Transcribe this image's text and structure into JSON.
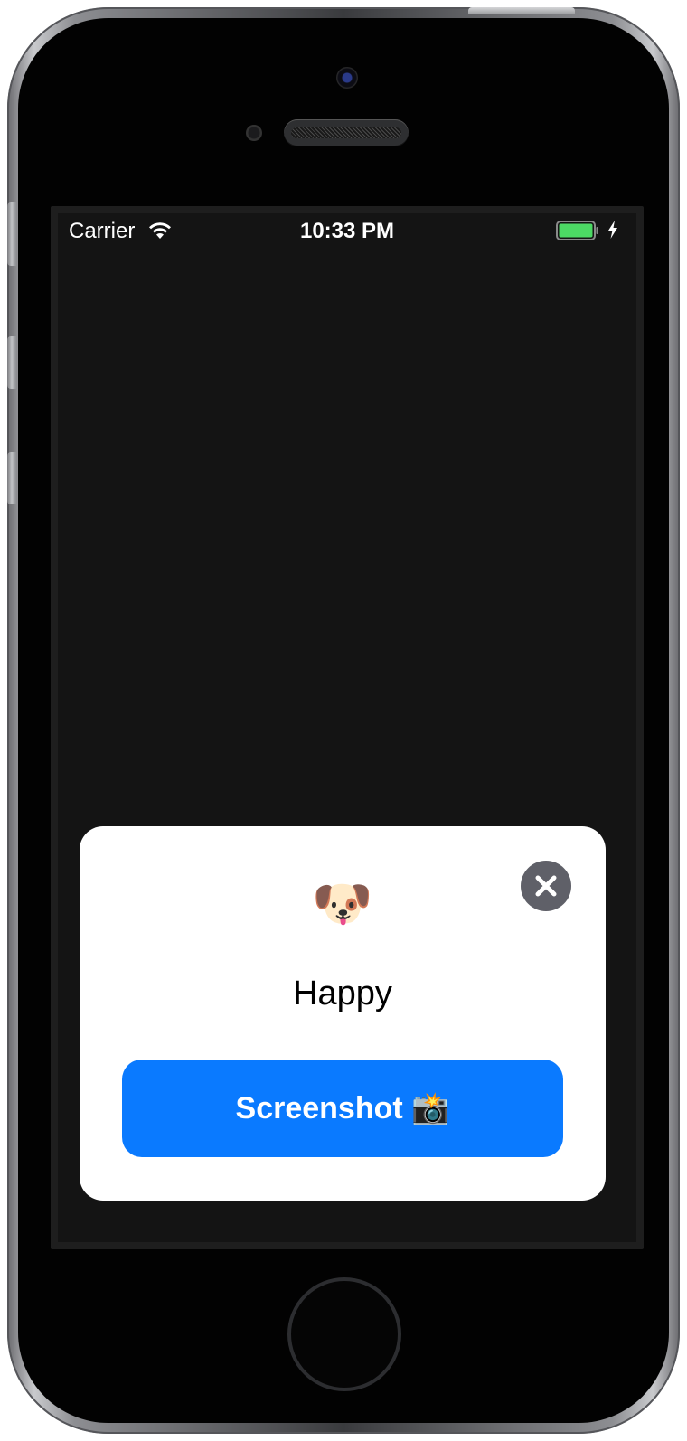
{
  "status_bar": {
    "carrier": "Carrier",
    "time": "10:33 PM",
    "wifi_icon": "wifi-icon",
    "battery_icon": "battery-icon",
    "charging_icon": "charging-icon",
    "battery_level": 1.0,
    "battery_color": "#4cd964"
  },
  "card": {
    "emoji": "🐶",
    "mood": "Happy",
    "close_icon": "close-icon",
    "screenshot_button_label": "Screenshot 📸",
    "button_color": "#0a7aff"
  }
}
